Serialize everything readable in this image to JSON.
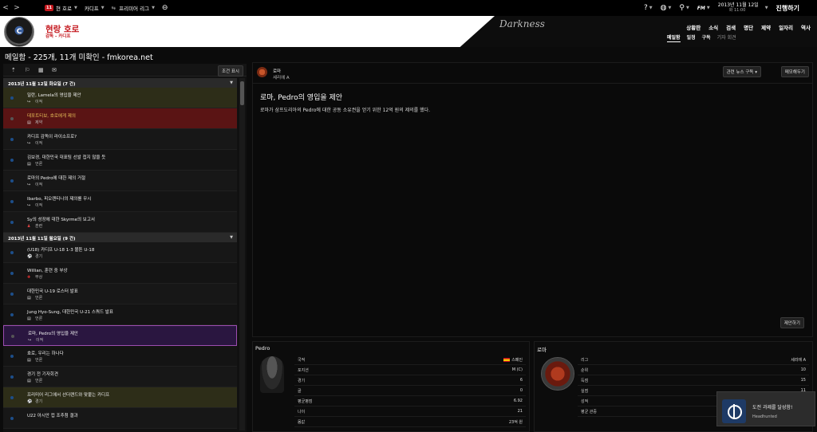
{
  "topbar": {
    "badge": "11",
    "club_menu": "현 호로",
    "club_menu_sub": "카디프",
    "league_menu": "프리미어 리그",
    "fm_label": "FM",
    "date": "2013년 11월 12일",
    "date_day": "화",
    "time": "11:00",
    "continue_label": "진행하기"
  },
  "header": {
    "club_name": "현랑 호로",
    "club_sub": "감독 - 카디프",
    "club_logo_text": "C",
    "skin_label": "Darkness",
    "main_nav": [
      "상황판",
      "소식",
      "검색",
      "명단",
      "제약",
      "일자리",
      "역사"
    ],
    "sub_nav": [
      "메일함",
      "일정",
      "구독",
      "기자 회견"
    ]
  },
  "page": {
    "title": "메일함 - 225개, 11개 미확인 - fmkorea.net"
  },
  "inbox": {
    "filter_label": "조건 표시",
    "groups": [
      {
        "date": "2013년 11월 12일 화요일 (7 건)",
        "messages": [
          {
            "title": "밀란, Lamela의 영입을 제안",
            "type": "이적",
            "icon": "↪",
            "style": "hl-olive"
          },
          {
            "title": "데포트티보, 호로에게 제의",
            "type": "제약",
            "icon": "▤",
            "style": "hl-red"
          },
          {
            "title": "카디프 감독이 라이소프로?",
            "type": "이적",
            "icon": "↪",
            "style": ""
          },
          {
            "title": "김보경, 대한민국 대표팀 선발 첩지 않을 듯",
            "type": "언론",
            "icon": "▤",
            "style": "alt"
          },
          {
            "title": "로마의 Pedro에 대한 제의 거절",
            "type": "이적",
            "icon": "↪",
            "style": ""
          },
          {
            "title": "Ibarbo, 피오렌티나의 제의를 무시",
            "type": "이적",
            "icon": "↪",
            "style": "alt"
          },
          {
            "title": "Sy의 성장에 대한 Skyrme의 보고서",
            "type": "훈련",
            "icon": "♟",
            "style": ""
          }
        ]
      },
      {
        "date": "2013년 11월 11일 월요일 (9 건)",
        "messages": [
          {
            "title": "(U18) 카디프 U-18 1-3 볼튼 U-18",
            "type": "경기",
            "icon": "⚽",
            "style": ""
          },
          {
            "title": "Willian, 훈련 중 부상",
            "type": "부상",
            "icon": "✚",
            "style": "alt"
          },
          {
            "title": "대한민국 U-19 로스터 발표",
            "type": "언론",
            "icon": "▤",
            "style": ""
          },
          {
            "title": "Jung Hyo-Sung, 대한민국 U-21 스쿼드 발표",
            "type": "언론",
            "icon": "▤",
            "style": "alt"
          },
          {
            "title": "로마, Pedro의 영입을 제안",
            "type": "이적",
            "icon": "↪",
            "style": "sel"
          },
          {
            "title": "호로, 우리는 하나다",
            "type": "언론",
            "icon": "▤",
            "style": "alt"
          },
          {
            "title": "경기 전 기자회견",
            "type": "언론",
            "icon": "▤",
            "style": ""
          },
          {
            "title": "프리미어 리그에서 선더랜드와 맞붙는 카디프",
            "type": "경기",
            "icon": "⚽",
            "style": "hl-olive"
          },
          {
            "title": "U22 아시안 컵 조추첨 결과",
            "type": "",
            "icon": "",
            "style": ""
          }
        ]
      }
    ]
  },
  "message": {
    "sender": "로마",
    "sender_sub": "세리에 A",
    "news_button": "관련 뉴스 구독 ▾",
    "memo_button": "메모해두기",
    "heading": "로마, Pedro의 영입을 제안",
    "body": "로마가 삼프도리아의 Pedro에 대한 공동 소유권을 얻기 위한 12억 원의 제의를 했다.",
    "propose_button": "제안하기"
  },
  "player_panel": {
    "title": "Pedro",
    "stats": [
      {
        "k": "국적",
        "v": "스페인",
        "flag": true
      },
      {
        "k": "포지션",
        "v": "M (C)"
      },
      {
        "k": "경기",
        "v": "6"
      },
      {
        "k": "골",
        "v": "0"
      },
      {
        "k": "평균평점",
        "v": "6.92"
      },
      {
        "k": "나이",
        "v": "21"
      },
      {
        "k": "몸값",
        "v": "23억 원"
      }
    ]
  },
  "club_panel": {
    "title": "로마",
    "stats": [
      {
        "k": "리그",
        "v": "세리에 A"
      },
      {
        "k": "순위",
        "v": "10"
      },
      {
        "k": "득점",
        "v": "15"
      },
      {
        "k": "실점",
        "v": "11"
      },
      {
        "k": "성적",
        "v": ""
      },
      {
        "k": "평균 관중",
        "v": ""
      }
    ]
  },
  "achievement": {
    "title": "도전 과제를 달성함!",
    "subtitle": "Headhunted"
  }
}
